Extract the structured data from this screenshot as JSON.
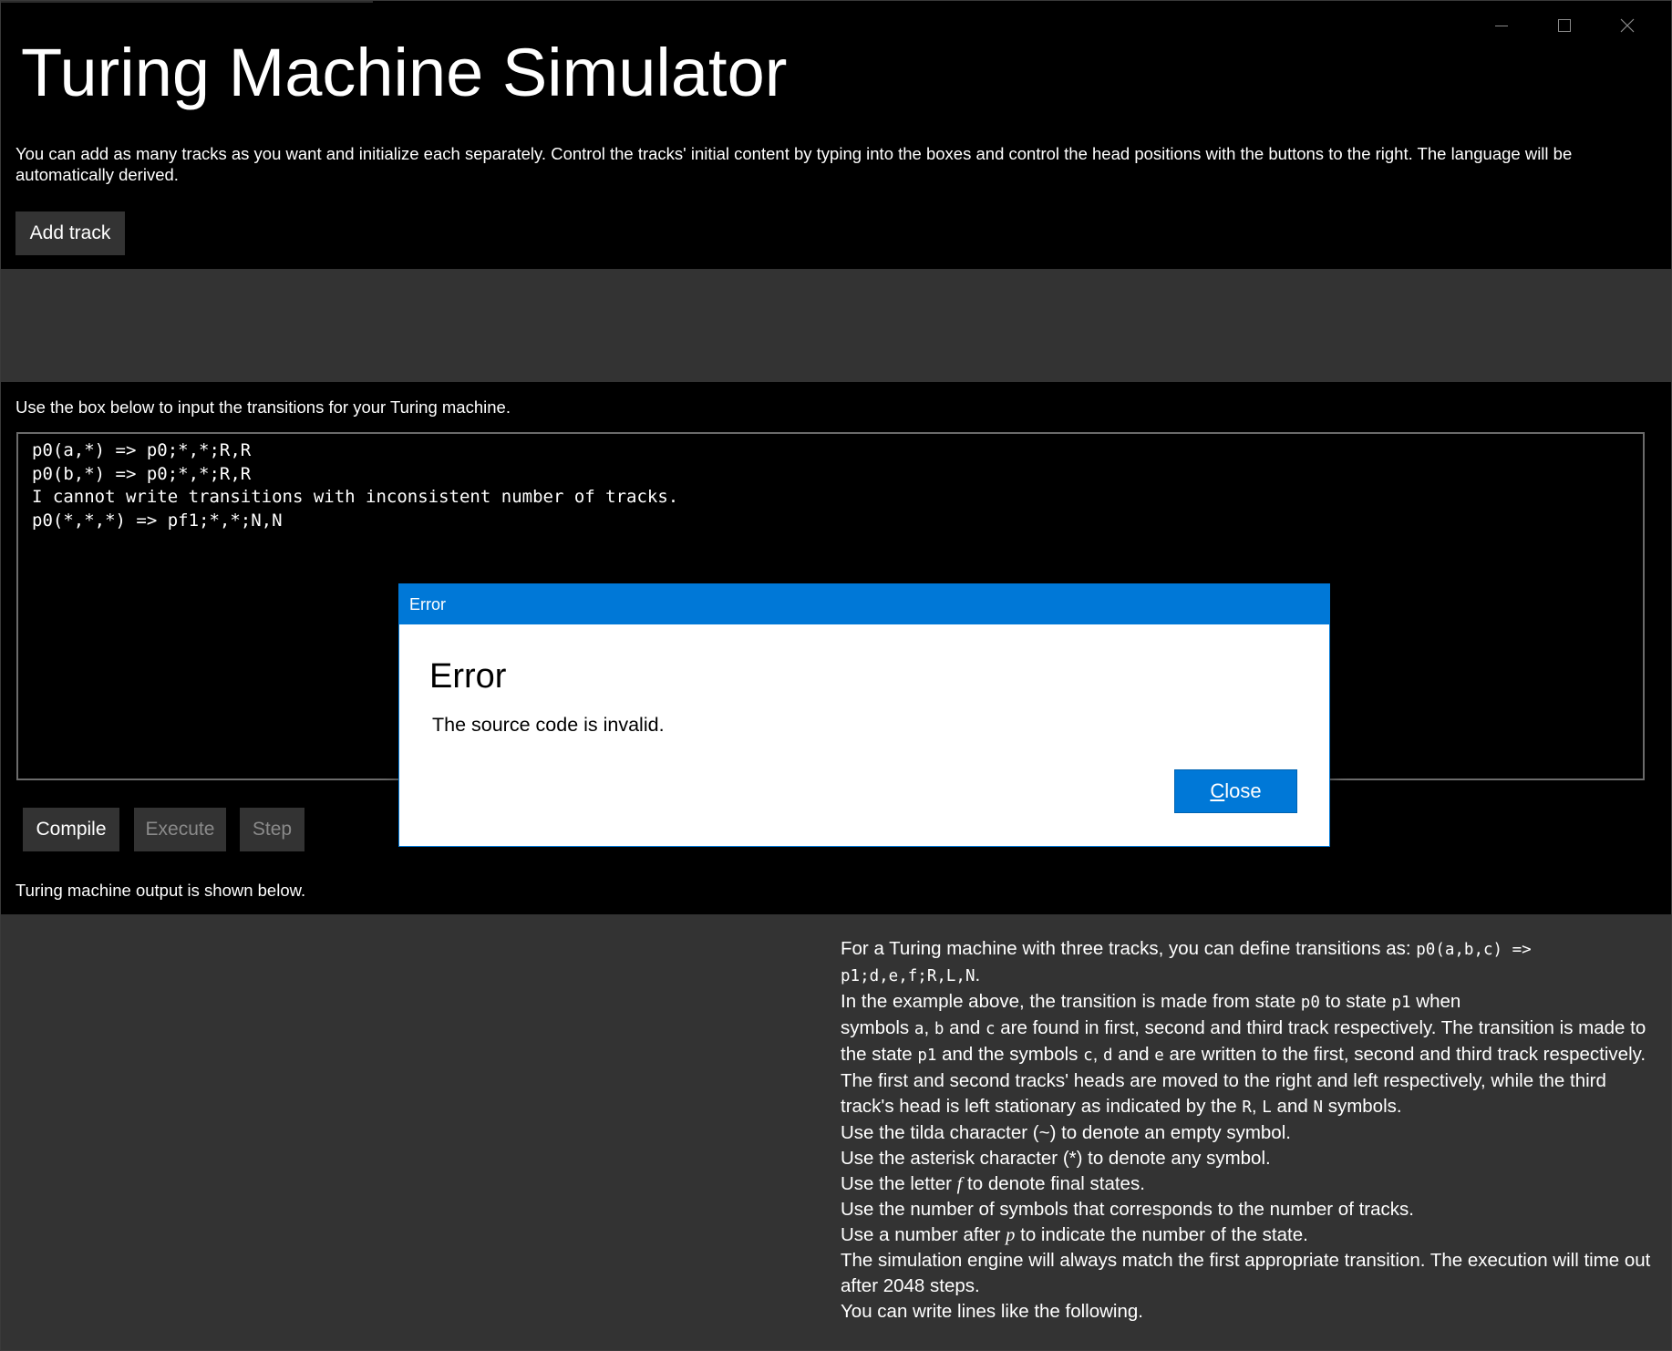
{
  "window": {
    "title": "Turing Machine Simulator",
    "controls": {
      "minimize_icon": "minimize-icon",
      "maximize_icon": "maximize-icon",
      "close_icon": "close-icon"
    }
  },
  "intro_text": "You can add as many tracks as you want and initialize each separately. Control the tracks' initial content by typing into the boxes and control the head positions with the buttons to the right. The language will be automatically derived.",
  "add_track_label": "Add track",
  "transitions_label": "Use the box below to input the transitions for your Turing machine.",
  "source_code": "p0(a,*) => p0;*,*;R,R\np0(b,*) => p0;*,*;R,R\nI cannot write transitions with inconsistent number of tracks.\np0(*,*,*) => pf1;*,*;N,N",
  "buttons": {
    "compile": "Compile",
    "execute": "Execute",
    "step": "Step"
  },
  "output_label": "Turing machine output is shown below.",
  "help": {
    "l1a": "For a Turing machine with three tracks, you can define transitions as: ",
    "l1code": "p0(a,b,c) => p1;d,e,f;R,L,N",
    "l1b": ".",
    "l2a": "In the example above, the transition is made from state ",
    "l2c1": "p0",
    "l2b": " to state ",
    "l2c2": "p1",
    "l2c": " when",
    "l3a": "symbols ",
    "l3c1": "a",
    "l3b": ", ",
    "l3c2": "b",
    "l3c": " and ",
    "l3c3": "c",
    "l3d": " are found in first, second and third track respectively. The transition is made to the state ",
    "l3c4": "p1",
    "l3e": " and the symbols ",
    "l3c5": "c",
    "l3f": ", ",
    "l3c6": "d",
    "l3g": " and ",
    "l3c7": "e",
    "l3h": " are written to the first, second and third track respectively. The first and second tracks' heads are moved to the right and left respectively, while the third track's head is left stationary as indicated by the ",
    "l3c8": "R",
    "l3i": ", ",
    "l3c9": "L",
    "l3j": " and ",
    "l3c10": "N",
    "l3k": " symbols.",
    "tilda": "Use the tilda character (~) to denote an empty symbol.",
    "asterisk": "Use the asterisk character (*) to denote any symbol.",
    "final_a": "Use the letter ",
    "final_f": "f",
    "final_b": " to denote final states.",
    "num_symbols": "Use the number of symbols that corresponds to the number of tracks.",
    "state_a": "Use a number after ",
    "state_p": "p",
    "state_b": " to indicate the number of the state.",
    "engine": "The simulation engine will always match the first appropriate transition. The execution will time out after 2048 steps.",
    "lines": "You can write lines like the following."
  },
  "dialog": {
    "title": "Error",
    "heading": "Error",
    "message": "The source code is invalid.",
    "close_accel": "C",
    "close_rest": "lose"
  },
  "colors": {
    "background": "#000000",
    "panel": "#333333",
    "accent": "#0078d7"
  }
}
